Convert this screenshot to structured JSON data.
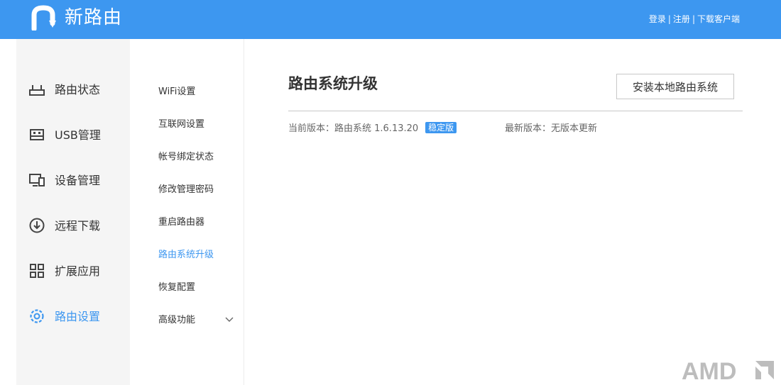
{
  "header": {
    "logo_text": "新路由",
    "links": {
      "login": "登录",
      "register": "注册",
      "download": "下载客户端",
      "separator": "|"
    },
    "bg_color": "#3d97f0"
  },
  "sidebar": {
    "items": [
      {
        "label": "路由状态",
        "icon": "router-icon",
        "active": false
      },
      {
        "label": "USB管理",
        "icon": "usb-icon",
        "active": false
      },
      {
        "label": "设备管理",
        "icon": "devices-icon",
        "active": false
      },
      {
        "label": "远程下载",
        "icon": "download-icon",
        "active": false
      },
      {
        "label": "扩展应用",
        "icon": "apps-grid-icon",
        "active": false
      },
      {
        "label": "路由设置",
        "icon": "settings-gear-icon",
        "active": true
      }
    ]
  },
  "subnav": {
    "items": [
      {
        "label": "WiFi设置",
        "active": false
      },
      {
        "label": "互联网设置",
        "active": false
      },
      {
        "label": "帐号绑定状态",
        "active": false
      },
      {
        "label": "修改管理密码",
        "active": false
      },
      {
        "label": "重启路由器",
        "active": false
      },
      {
        "label": "路由系统升级",
        "active": true
      },
      {
        "label": "恢复配置",
        "active": false
      },
      {
        "label": "高级功能",
        "active": false,
        "expandable": true
      }
    ]
  },
  "main": {
    "title": "路由系统升级",
    "install_button": "安装本地路由系统",
    "current_version_label": "当前版本：路由系统 1.6.13.20",
    "stable_badge": "稳定版",
    "latest_version_label": "最新版本：无版本更新"
  },
  "watermark": {
    "text": "AMD"
  },
  "colors": {
    "accent": "#3d97f0",
    "text": "#333333",
    "muted": "#666666"
  }
}
